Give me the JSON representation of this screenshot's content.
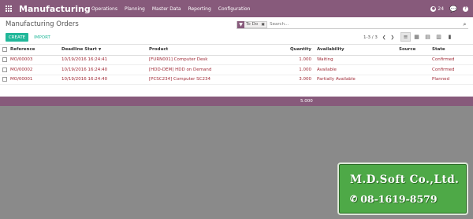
{
  "header": {
    "app_title": "Manufacturing",
    "menu": [
      "Operations",
      "Planning",
      "Master Data",
      "Reporting",
      "Configuration"
    ],
    "notification_count": "24"
  },
  "control": {
    "page_title": "Manufacturing Orders",
    "facet_label": "To Do",
    "search_placeholder": "Search...",
    "create_label": "CREATE",
    "import_label": "IMPORT",
    "pager_text": "1-3 / 3"
  },
  "table": {
    "columns": [
      "Reference",
      "Deadline Start",
      "Product",
      "Quantity",
      "Availability",
      "Source",
      "State"
    ],
    "rows": [
      [
        "MO/00003",
        "10/19/2016 16:24:41",
        "[FURN001] Computer Desk",
        "1.000",
        "Waiting",
        "",
        "Confirmed"
      ],
      [
        "MO/00002",
        "10/19/2016 16:24:40",
        "[HDD-DEM] HDD on Demand",
        "1.000",
        "Available",
        "",
        "Confirmed"
      ],
      [
        "MO/00001",
        "10/19/2016 16:24:40",
        "[PCSC234] Computer SC234",
        "3.000",
        "Partially Available",
        "",
        "Planned"
      ]
    ],
    "quantity_total": "5.000"
  },
  "watermark": {
    "company": "M.D.Soft Co.,Ltd.",
    "phone": "08-1619-8579"
  },
  "colors": {
    "brand": "#875a7b",
    "accent": "#21b799",
    "link_red": "#a02c38",
    "watermark_green": "#4ea947"
  },
  "icons": {
    "apps": "grid-icon",
    "facet": "filter-icon",
    "search": "search-icon",
    "pager_prev": "chevron-left-icon",
    "pager_next": "chevron-right-icon",
    "views": [
      "list-view-icon",
      "kanban-view-icon",
      "calendar-view-icon",
      "pivot-view-icon",
      "graph-view-icon"
    ],
    "topright": [
      "activity-icon",
      "chat-icon",
      "help-icon"
    ]
  }
}
